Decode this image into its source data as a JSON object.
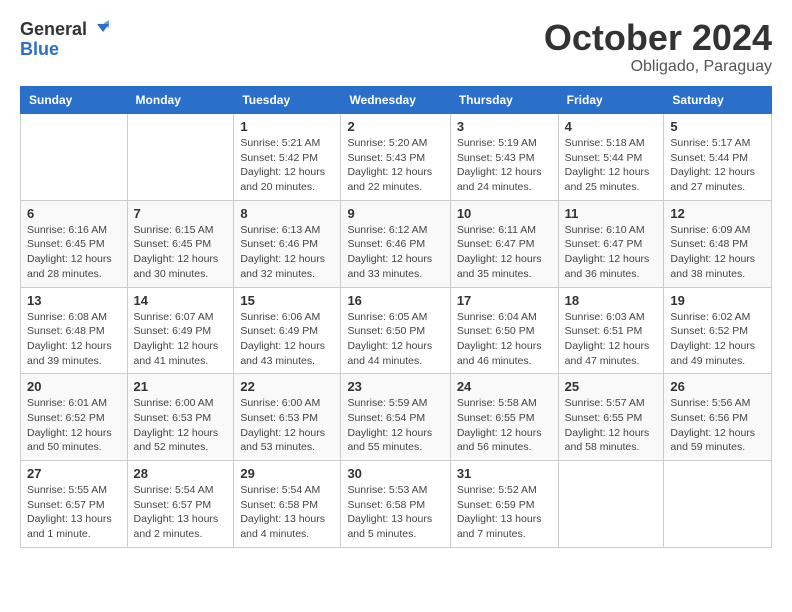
{
  "header": {
    "logo_line1": "General",
    "logo_line2": "Blue",
    "title": "October 2024",
    "subtitle": "Obligado, Paraguay"
  },
  "weekdays": [
    "Sunday",
    "Monday",
    "Tuesday",
    "Wednesday",
    "Thursday",
    "Friday",
    "Saturday"
  ],
  "weeks": [
    [
      {
        "day": "",
        "info": ""
      },
      {
        "day": "",
        "info": ""
      },
      {
        "day": "1",
        "info": "Sunrise: 5:21 AM\nSunset: 5:42 PM\nDaylight: 12 hours and 20 minutes."
      },
      {
        "day": "2",
        "info": "Sunrise: 5:20 AM\nSunset: 5:43 PM\nDaylight: 12 hours and 22 minutes."
      },
      {
        "day": "3",
        "info": "Sunrise: 5:19 AM\nSunset: 5:43 PM\nDaylight: 12 hours and 24 minutes."
      },
      {
        "day": "4",
        "info": "Sunrise: 5:18 AM\nSunset: 5:44 PM\nDaylight: 12 hours and 25 minutes."
      },
      {
        "day": "5",
        "info": "Sunrise: 5:17 AM\nSunset: 5:44 PM\nDaylight: 12 hours and 27 minutes."
      }
    ],
    [
      {
        "day": "6",
        "info": "Sunrise: 6:16 AM\nSunset: 6:45 PM\nDaylight: 12 hours and 28 minutes."
      },
      {
        "day": "7",
        "info": "Sunrise: 6:15 AM\nSunset: 6:45 PM\nDaylight: 12 hours and 30 minutes."
      },
      {
        "day": "8",
        "info": "Sunrise: 6:13 AM\nSunset: 6:46 PM\nDaylight: 12 hours and 32 minutes."
      },
      {
        "day": "9",
        "info": "Sunrise: 6:12 AM\nSunset: 6:46 PM\nDaylight: 12 hours and 33 minutes."
      },
      {
        "day": "10",
        "info": "Sunrise: 6:11 AM\nSunset: 6:47 PM\nDaylight: 12 hours and 35 minutes."
      },
      {
        "day": "11",
        "info": "Sunrise: 6:10 AM\nSunset: 6:47 PM\nDaylight: 12 hours and 36 minutes."
      },
      {
        "day": "12",
        "info": "Sunrise: 6:09 AM\nSunset: 6:48 PM\nDaylight: 12 hours and 38 minutes."
      }
    ],
    [
      {
        "day": "13",
        "info": "Sunrise: 6:08 AM\nSunset: 6:48 PM\nDaylight: 12 hours and 39 minutes."
      },
      {
        "day": "14",
        "info": "Sunrise: 6:07 AM\nSunset: 6:49 PM\nDaylight: 12 hours and 41 minutes."
      },
      {
        "day": "15",
        "info": "Sunrise: 6:06 AM\nSunset: 6:49 PM\nDaylight: 12 hours and 43 minutes."
      },
      {
        "day": "16",
        "info": "Sunrise: 6:05 AM\nSunset: 6:50 PM\nDaylight: 12 hours and 44 minutes."
      },
      {
        "day": "17",
        "info": "Sunrise: 6:04 AM\nSunset: 6:50 PM\nDaylight: 12 hours and 46 minutes."
      },
      {
        "day": "18",
        "info": "Sunrise: 6:03 AM\nSunset: 6:51 PM\nDaylight: 12 hours and 47 minutes."
      },
      {
        "day": "19",
        "info": "Sunrise: 6:02 AM\nSunset: 6:52 PM\nDaylight: 12 hours and 49 minutes."
      }
    ],
    [
      {
        "day": "20",
        "info": "Sunrise: 6:01 AM\nSunset: 6:52 PM\nDaylight: 12 hours and 50 minutes."
      },
      {
        "day": "21",
        "info": "Sunrise: 6:00 AM\nSunset: 6:53 PM\nDaylight: 12 hours and 52 minutes."
      },
      {
        "day": "22",
        "info": "Sunrise: 6:00 AM\nSunset: 6:53 PM\nDaylight: 12 hours and 53 minutes."
      },
      {
        "day": "23",
        "info": "Sunrise: 5:59 AM\nSunset: 6:54 PM\nDaylight: 12 hours and 55 minutes."
      },
      {
        "day": "24",
        "info": "Sunrise: 5:58 AM\nSunset: 6:55 PM\nDaylight: 12 hours and 56 minutes."
      },
      {
        "day": "25",
        "info": "Sunrise: 5:57 AM\nSunset: 6:55 PM\nDaylight: 12 hours and 58 minutes."
      },
      {
        "day": "26",
        "info": "Sunrise: 5:56 AM\nSunset: 6:56 PM\nDaylight: 12 hours and 59 minutes."
      }
    ],
    [
      {
        "day": "27",
        "info": "Sunrise: 5:55 AM\nSunset: 6:57 PM\nDaylight: 13 hours and 1 minute."
      },
      {
        "day": "28",
        "info": "Sunrise: 5:54 AM\nSunset: 6:57 PM\nDaylight: 13 hours and 2 minutes."
      },
      {
        "day": "29",
        "info": "Sunrise: 5:54 AM\nSunset: 6:58 PM\nDaylight: 13 hours and 4 minutes."
      },
      {
        "day": "30",
        "info": "Sunrise: 5:53 AM\nSunset: 6:58 PM\nDaylight: 13 hours and 5 minutes."
      },
      {
        "day": "31",
        "info": "Sunrise: 5:52 AM\nSunset: 6:59 PM\nDaylight: 13 hours and 7 minutes."
      },
      {
        "day": "",
        "info": ""
      },
      {
        "day": "",
        "info": ""
      }
    ]
  ]
}
